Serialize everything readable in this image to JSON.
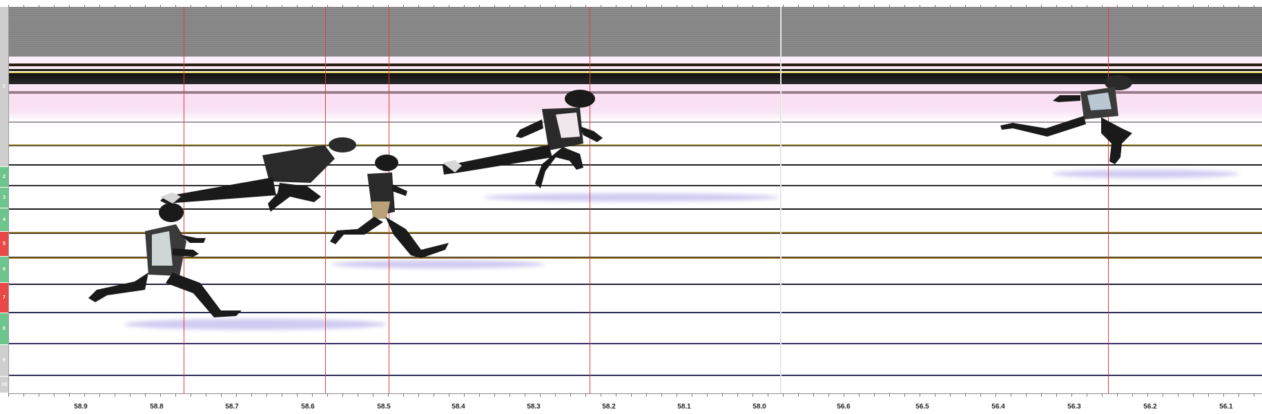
{
  "lane_strip": {
    "lanes": [
      {
        "label": "1",
        "color": "#cfcfcf"
      },
      {
        "label": "2",
        "color": "#6dc48d"
      },
      {
        "label": "3",
        "color": "#6dc48d"
      },
      {
        "label": "4",
        "color": "#6dc48d"
      },
      {
        "label": "5",
        "color": "#e94848"
      },
      {
        "label": "6",
        "color": "#6dc48d"
      },
      {
        "label": "7",
        "color": "#e94848"
      },
      {
        "label": "8",
        "color": "#6dc48d"
      },
      {
        "label": "9",
        "color": "#cfcfcf"
      },
      {
        "label": "10",
        "color": "#cfcfcf"
      }
    ]
  },
  "timeline": {
    "ticks": [
      "58.9",
      "58.8",
      "58.7",
      "58.6",
      "58.5",
      "58.4",
      "58.3",
      "58.2",
      "58.1",
      "58.0",
      "56.6",
      "56.5",
      "56.4",
      "56.3",
      "56.2",
      "56.1"
    ]
  },
  "colors": {
    "cursor": "#e03a3a",
    "lane_green": "#6dc48d",
    "lane_red": "#e94848"
  }
}
